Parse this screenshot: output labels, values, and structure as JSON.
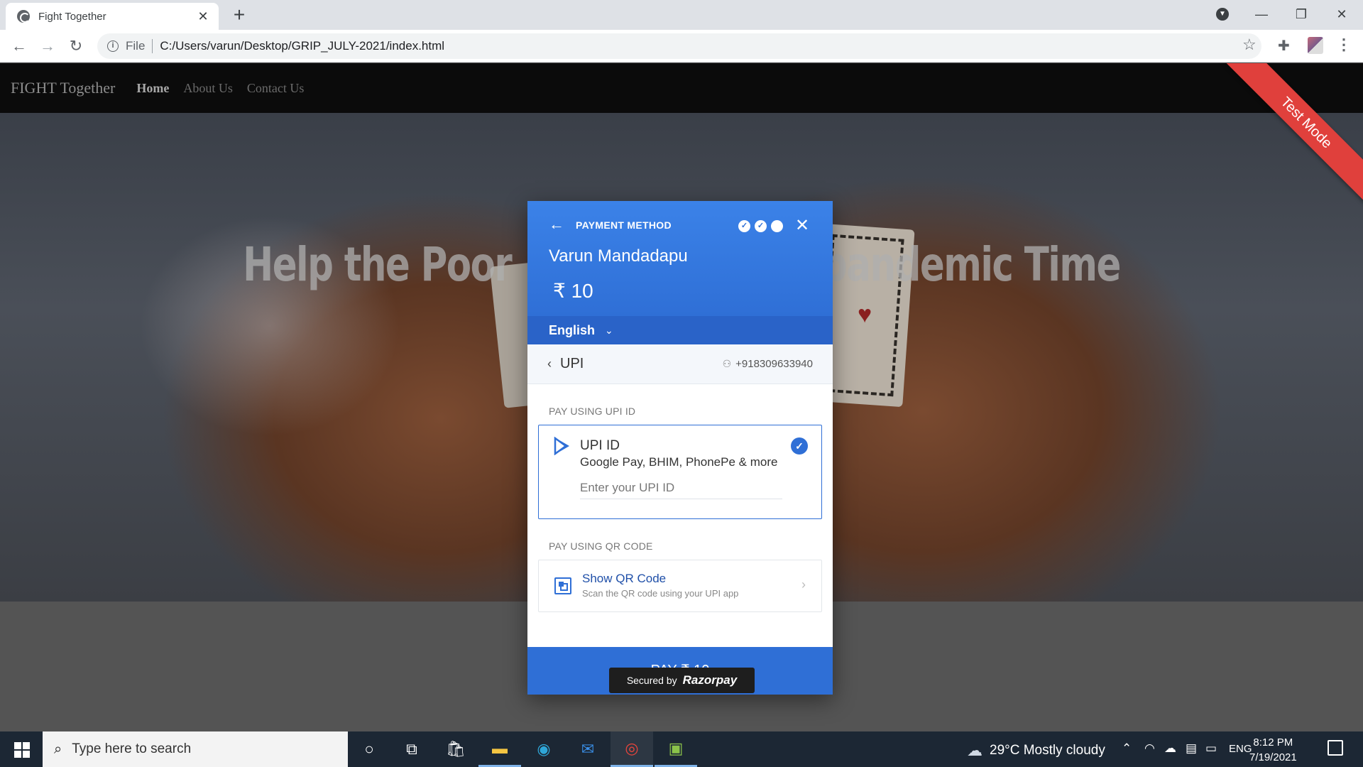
{
  "browser": {
    "tab_title": "Fight Together",
    "tab_close": "✕",
    "new_tab": "+",
    "address_info": "i",
    "address_scheme": "File",
    "address_url": "C:/Users/varun/Desktop/GRIP_JULY-2021/index.html",
    "window_minimize": "—",
    "window_restore": "❐",
    "window_close": "✕"
  },
  "site": {
    "brand": "FIGHT Together",
    "nav": [
      {
        "label": "Home",
        "active": true
      },
      {
        "label": "About Us",
        "active": false
      },
      {
        "label": "Contact Us",
        "active": false
      }
    ],
    "hero_title_left": "Help the Poor",
    "hero_title_right": "pandemic Time",
    "test_mode_ribbon": "Test Mode"
  },
  "razorpay": {
    "back_arrow": "←",
    "title": "PAYMENT METHOD",
    "step_marks": [
      "✓",
      "✓",
      ""
    ],
    "close": "✕",
    "merchant_name": "Varun Mandadapu",
    "amount": "₹ 10",
    "language": "English",
    "language_chevron": "⌄",
    "method_back": "‹",
    "method": "UPI",
    "contact": "+918309633940",
    "section_upi_id": "PAY USING UPI ID",
    "upi_option_label": "UPI ID",
    "upi_option_apps": "Google Pay, BHIM, PhonePe & more",
    "upi_input_placeholder": "Enter your UPI ID",
    "upi_selected_mark": "✓",
    "section_qr": "PAY USING QR CODE",
    "qr_title": "Show QR Code",
    "qr_subtitle": "Scan the QR code using your UPI app",
    "qr_arrow": "›",
    "pay_button": "PAY ₹ 10",
    "secured_by": "Secured by",
    "secured_brand": "Razorpay",
    "accent_color": "#2f6fd6"
  },
  "taskbar": {
    "search_placeholder": "Type here to search",
    "weather": "29°C  Mostly cloudy",
    "language": "ENG",
    "time": "8:12 PM",
    "date": "7/19/2021"
  }
}
